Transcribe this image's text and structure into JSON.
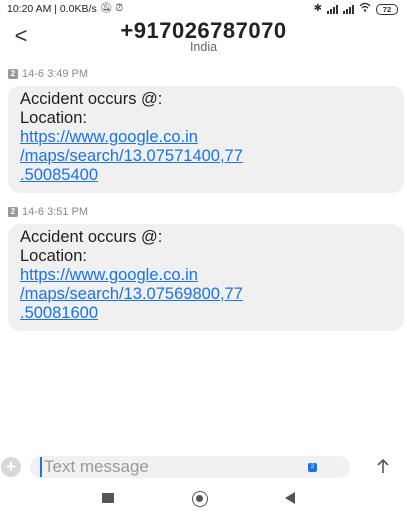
{
  "status_bar": {
    "time_info": "10:20 AM | 0.0KB/s",
    "battery": "72",
    "icons": [
      "mute-icon",
      "alarm-icon",
      "bluetooth-icon",
      "signal-icon",
      "signal-icon",
      "wifi-icon",
      "battery-icon"
    ]
  },
  "header": {
    "back_glyph": "<",
    "contact": "+917026787070",
    "subtitle": "India"
  },
  "messages": [
    {
      "sim": "2",
      "timestamp": "14-6 3:49 PM",
      "lines": [
        "Accident occurs @:",
        "Location:"
      ],
      "link_lines": [
        "https://www.google.co.in",
        "/maps/search/13.07571400,77",
        ".50085400"
      ]
    },
    {
      "sim": "2",
      "timestamp": "14-6 3:51 PM",
      "lines": [
        "Accident occurs @:",
        "Location:"
      ],
      "link_lines": [
        "https://www.google.co.in",
        "/maps/search/13.07569800,77",
        ".50081600"
      ]
    }
  ],
  "composer": {
    "add_glyph": "+",
    "placeholder": "Text message",
    "sim_badge": "2"
  },
  "colors": {
    "link": "#1a73e8",
    "bubble": "#f0f0f0",
    "accent": "#1a73e8"
  }
}
